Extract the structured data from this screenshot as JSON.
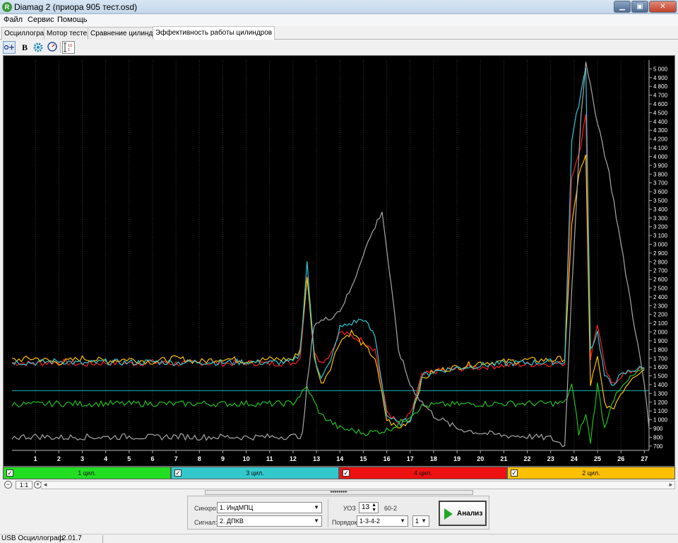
{
  "window": {
    "icon_letter": "R",
    "title": "Diamag 2 (приора 905 тест.osd)",
    "btn_minimize": "▁",
    "btn_maximize": "▣",
    "btn_close": "✕"
  },
  "menu": [
    "Файл",
    "Сервис",
    "Помощь"
  ],
  "tabs": [
    "Осциллограф",
    "Мотор тестер",
    "Сравнение цилиндров",
    "Эффективность работы цилиндров"
  ],
  "active_tab_index": 3,
  "toolbar": {
    "icons": [
      "scale-icon",
      "bold-icon",
      "gear-icon",
      "rpm-icon",
      "range-icon"
    ],
    "rpm_label": "RPM"
  },
  "chart_data": {
    "type": "line",
    "background": "#000000",
    "grid": true,
    "x_ticks": [
      1,
      2,
      3,
      4,
      5,
      6,
      7,
      8,
      9,
      10,
      11,
      12,
      13,
      14,
      15,
      16,
      17,
      18,
      19,
      20,
      21,
      22,
      23,
      24,
      25,
      26,
      27
    ],
    "y_ticks": [
      "700",
      "800",
      "900",
      "1 000",
      "1 100",
      "1 200",
      "1 300",
      "1 400",
      "1 500",
      "1 600",
      "1 700",
      "1 800",
      "1 900",
      "2 000",
      "2 100",
      "2 200",
      "2 300",
      "2 400",
      "2 500",
      "2 600",
      "2 700",
      "2 800",
      "2 900",
      "3 000",
      "3 100",
      "3 200",
      "3 300",
      "3 400",
      "3 500",
      "3 600",
      "3 700",
      "3 800",
      "3 900",
      "4 000",
      "4 100",
      "4 200",
      "4 300",
      "4 400",
      "4 500",
      "4 600",
      "4 700",
      "4 800",
      "4 900",
      "5 000"
    ],
    "ylim": [
      650,
      5100
    ],
    "xlim": [
      0,
      27.2
    ],
    "reference_line": {
      "y": 1330,
      "color": "#1ab5b5"
    },
    "series": [
      {
        "color": "#ff2020",
        "values": [
          [
            0,
            1650
          ],
          [
            1,
            1640
          ],
          [
            2,
            1660
          ],
          [
            3,
            1630
          ],
          [
            4,
            1650
          ],
          [
            5,
            1640
          ],
          [
            6,
            1655
          ],
          [
            7,
            1640
          ],
          [
            8,
            1650
          ],
          [
            9,
            1640
          ],
          [
            10,
            1650
          ],
          [
            11,
            1640
          ],
          [
            12,
            1650
          ],
          [
            12.3,
            1700
          ],
          [
            12.6,
            2650
          ],
          [
            12.9,
            1800
          ],
          [
            13.2,
            1650
          ],
          [
            13.6,
            1750
          ],
          [
            14,
            2000
          ],
          [
            14.5,
            1950
          ],
          [
            15,
            1900
          ],
          [
            15.5,
            1800
          ],
          [
            16,
            1100
          ],
          [
            16.5,
            950
          ],
          [
            17,
            1050
          ],
          [
            17.5,
            1500
          ],
          [
            18,
            1550
          ],
          [
            19,
            1580
          ],
          [
            20,
            1600
          ],
          [
            21,
            1620
          ],
          [
            22,
            1630
          ],
          [
            23,
            1640
          ],
          [
            23.6,
            1640
          ],
          [
            23.9,
            3800
          ],
          [
            24.2,
            4000
          ],
          [
            24.5,
            4500
          ],
          [
            24.7,
            1700
          ],
          [
            25,
            2100
          ],
          [
            25.3,
            1600
          ],
          [
            25.6,
            1400
          ],
          [
            26,
            1500
          ],
          [
            26.5,
            1560
          ],
          [
            27,
            1580
          ]
        ]
      },
      {
        "color": "#ffc000",
        "values": [
          [
            0,
            1680
          ],
          [
            1,
            1700
          ],
          [
            2,
            1650
          ],
          [
            3,
            1700
          ],
          [
            4,
            1670
          ],
          [
            5,
            1690
          ],
          [
            6,
            1660
          ],
          [
            7,
            1700
          ],
          [
            8,
            1660
          ],
          [
            9,
            1700
          ],
          [
            10,
            1670
          ],
          [
            11,
            1690
          ],
          [
            12,
            1690
          ],
          [
            12.3,
            1800
          ],
          [
            12.6,
            2600
          ],
          [
            12.9,
            1750
          ],
          [
            13.2,
            1400
          ],
          [
            13.6,
            1600
          ],
          [
            14,
            1900
          ],
          [
            14.5,
            2000
          ],
          [
            15,
            1850
          ],
          [
            15.5,
            1700
          ],
          [
            16,
            1000
          ],
          [
            16.5,
            900
          ],
          [
            17,
            1000
          ],
          [
            17.5,
            1450
          ],
          [
            18,
            1550
          ],
          [
            19,
            1600
          ],
          [
            20,
            1650
          ],
          [
            21,
            1660
          ],
          [
            22,
            1680
          ],
          [
            23,
            1680
          ],
          [
            23.6,
            1700
          ],
          [
            23.9,
            3200
          ],
          [
            24.2,
            3800
          ],
          [
            24.5,
            4000
          ],
          [
            24.7,
            1400
          ],
          [
            25,
            1700
          ],
          [
            25.3,
            1200
          ],
          [
            25.6,
            1100
          ],
          [
            26,
            1300
          ],
          [
            26.5,
            1500
          ],
          [
            27,
            1570
          ]
        ]
      },
      {
        "color": "#30c8d8",
        "values": [
          [
            0,
            1660
          ],
          [
            1,
            1650
          ],
          [
            2,
            1670
          ],
          [
            3,
            1640
          ],
          [
            4,
            1660
          ],
          [
            5,
            1650
          ],
          [
            6,
            1660
          ],
          [
            7,
            1650
          ],
          [
            8,
            1660
          ],
          [
            9,
            1650
          ],
          [
            10,
            1660
          ],
          [
            11,
            1650
          ],
          [
            12,
            1660
          ],
          [
            12.3,
            1750
          ],
          [
            12.6,
            2800
          ],
          [
            12.9,
            1700
          ],
          [
            13.2,
            1500
          ],
          [
            13.6,
            1650
          ],
          [
            14,
            2050
          ],
          [
            14.5,
            2100
          ],
          [
            15,
            2150
          ],
          [
            15.5,
            1950
          ],
          [
            16,
            1050
          ],
          [
            16.5,
            950
          ],
          [
            17,
            1000
          ],
          [
            17.5,
            1500
          ],
          [
            18,
            1550
          ],
          [
            19,
            1590
          ],
          [
            20,
            1620
          ],
          [
            21,
            1640
          ],
          [
            22,
            1650
          ],
          [
            23,
            1660
          ],
          [
            23.6,
            1660
          ],
          [
            23.9,
            4200
          ],
          [
            24.2,
            4600
          ],
          [
            24.5,
            5000
          ],
          [
            24.7,
            1800
          ],
          [
            25,
            2000
          ],
          [
            25.3,
            1500
          ],
          [
            25.6,
            1400
          ],
          [
            26,
            1500
          ],
          [
            26.5,
            1570
          ],
          [
            27,
            1590
          ]
        ]
      },
      {
        "color": "#20c020",
        "values": [
          [
            0,
            1180
          ],
          [
            1,
            1175
          ],
          [
            2,
            1185
          ],
          [
            3,
            1180
          ],
          [
            4,
            1185
          ],
          [
            5,
            1180
          ],
          [
            6,
            1185
          ],
          [
            7,
            1180
          ],
          [
            8,
            1185
          ],
          [
            9,
            1180
          ],
          [
            10,
            1185
          ],
          [
            11,
            1180
          ],
          [
            12,
            1190
          ],
          [
            12.3,
            1280
          ],
          [
            12.6,
            1370
          ],
          [
            12.9,
            1200
          ],
          [
            13.2,
            1050
          ],
          [
            13.6,
            980
          ],
          [
            14,
            900
          ],
          [
            14.5,
            880
          ],
          [
            15,
            850
          ],
          [
            15.5,
            860
          ],
          [
            16,
            880
          ],
          [
            16.5,
            950
          ],
          [
            17,
            1050
          ],
          [
            17.5,
            1150
          ],
          [
            18,
            1170
          ],
          [
            19,
            1175
          ],
          [
            20,
            1180
          ],
          [
            21,
            1185
          ],
          [
            22,
            1185
          ],
          [
            23,
            1185
          ],
          [
            23.6,
            1190
          ],
          [
            23.9,
            1400
          ],
          [
            24.2,
            850
          ],
          [
            24.5,
            1050
          ],
          [
            24.7,
            750
          ],
          [
            25,
            1400
          ],
          [
            25.3,
            900
          ],
          [
            25.6,
            1200
          ],
          [
            26,
            1350
          ],
          [
            26.5,
            1500
          ],
          [
            27,
            1570
          ]
        ]
      },
      {
        "color": "#a8a8a8",
        "values": [
          [
            0,
            800
          ],
          [
            1,
            810
          ],
          [
            2,
            795
          ],
          [
            3,
            805
          ],
          [
            4,
            800
          ],
          [
            5,
            810
          ],
          [
            6,
            800
          ],
          [
            7,
            810
          ],
          [
            8,
            800
          ],
          [
            9,
            805
          ],
          [
            10,
            800
          ],
          [
            11,
            805
          ],
          [
            12,
            810
          ],
          [
            12.4,
            820
          ],
          [
            12.6,
            1400
          ],
          [
            12.9,
            2100
          ],
          [
            13.5,
            2150
          ],
          [
            14,
            2250
          ],
          [
            14.5,
            2500
          ],
          [
            15,
            2900
          ],
          [
            15.5,
            3200
          ],
          [
            15.8,
            3380
          ],
          [
            16.2,
            2500
          ],
          [
            16.5,
            1800
          ],
          [
            17,
            1400
          ],
          [
            17.5,
            1200
          ],
          [
            18,
            1050
          ],
          [
            19,
            900
          ],
          [
            20,
            850
          ],
          [
            21,
            820
          ],
          [
            22,
            810
          ],
          [
            23,
            790
          ],
          [
            23.6,
            700
          ],
          [
            23.9,
            2500
          ],
          [
            24.3,
            4500
          ],
          [
            24.5,
            5050
          ],
          [
            25,
            4400
          ],
          [
            25.5,
            3800
          ],
          [
            26,
            3000
          ],
          [
            26.5,
            2200
          ],
          [
            27,
            1400
          ],
          [
            27.2,
            900
          ]
        ]
      }
    ]
  },
  "cylinders": [
    {
      "label": "1 цил.",
      "color": "#22dd22"
    },
    {
      "label": "3 цил.",
      "color": "#33c8cc"
    },
    {
      "label": "4 цил.",
      "color": "#ee1111"
    },
    {
      "label": "2 цил.",
      "color": "#ffc000"
    }
  ],
  "checkbox_glyph": "✓",
  "zoom": {
    "level": "1:1",
    "minus": "−",
    "plus": "+",
    "left_arrow": "◄",
    "right_arrow": "►"
  },
  "splitter_glyph": "▸▸▸▸▸▸▸▸",
  "settings": {
    "sync_label": "Синхро:",
    "sync_value": "1. ИндМПЦ",
    "signal_label": "Сигнал:",
    "signal_value": "2. ДПКВ",
    "uoz_label": "УОЗ",
    "uoz_value": "13",
    "teeth_value": "60-2",
    "order_label": "Порядок",
    "order_value": "1-3-4-2",
    "order_num": "1",
    "analyze_label": "Анализ"
  },
  "status": {
    "app": "USB Осциллограф",
    "version": "2.01.7"
  }
}
